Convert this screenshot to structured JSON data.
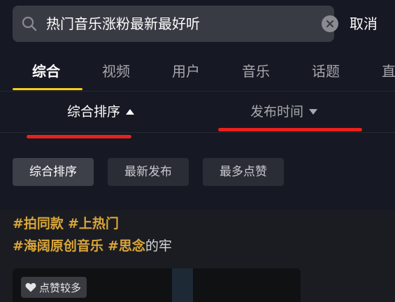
{
  "search": {
    "query": "热门音乐涨粉最新最好听",
    "cancel_label": "取消"
  },
  "tabs": [
    {
      "label": "综合",
      "active": true
    },
    {
      "label": "视频",
      "active": false
    },
    {
      "label": "用户",
      "active": false
    },
    {
      "label": "音乐",
      "active": false
    },
    {
      "label": "话题",
      "active": false
    },
    {
      "label": "直",
      "active": false
    }
  ],
  "sort": {
    "primary_label": "综合排序",
    "time_label": "发布时间"
  },
  "filters": [
    {
      "label": "综合排序",
      "selected": true
    },
    {
      "label": "最新发布",
      "selected": false
    },
    {
      "label": "最多点赞",
      "selected": false
    }
  ],
  "result": {
    "line1": [
      {
        "text": "#拍同款",
        "hashtag": true
      },
      {
        "text": " ",
        "hashtag": false
      },
      {
        "text": "#上热门",
        "hashtag": true
      }
    ],
    "line2": [
      {
        "text": "#海阔原创音乐",
        "hashtag": true
      },
      {
        "text": " ",
        "hashtag": false
      },
      {
        "text": "#思念",
        "hashtag": true
      },
      {
        "text": "的牢",
        "hashtag": false
      }
    ],
    "badge_label": "点赞较多"
  },
  "colors": {
    "background": "#161823",
    "accent_yellow": "#face15",
    "highlight_red": "#e8211c",
    "hashtag_gold": "#d9a63a"
  },
  "icons": {
    "search": "search-icon",
    "clear": "clear-icon",
    "sort_asc": "caret-up-icon",
    "sort_desc": "caret-down-icon",
    "like": "heart-icon"
  }
}
